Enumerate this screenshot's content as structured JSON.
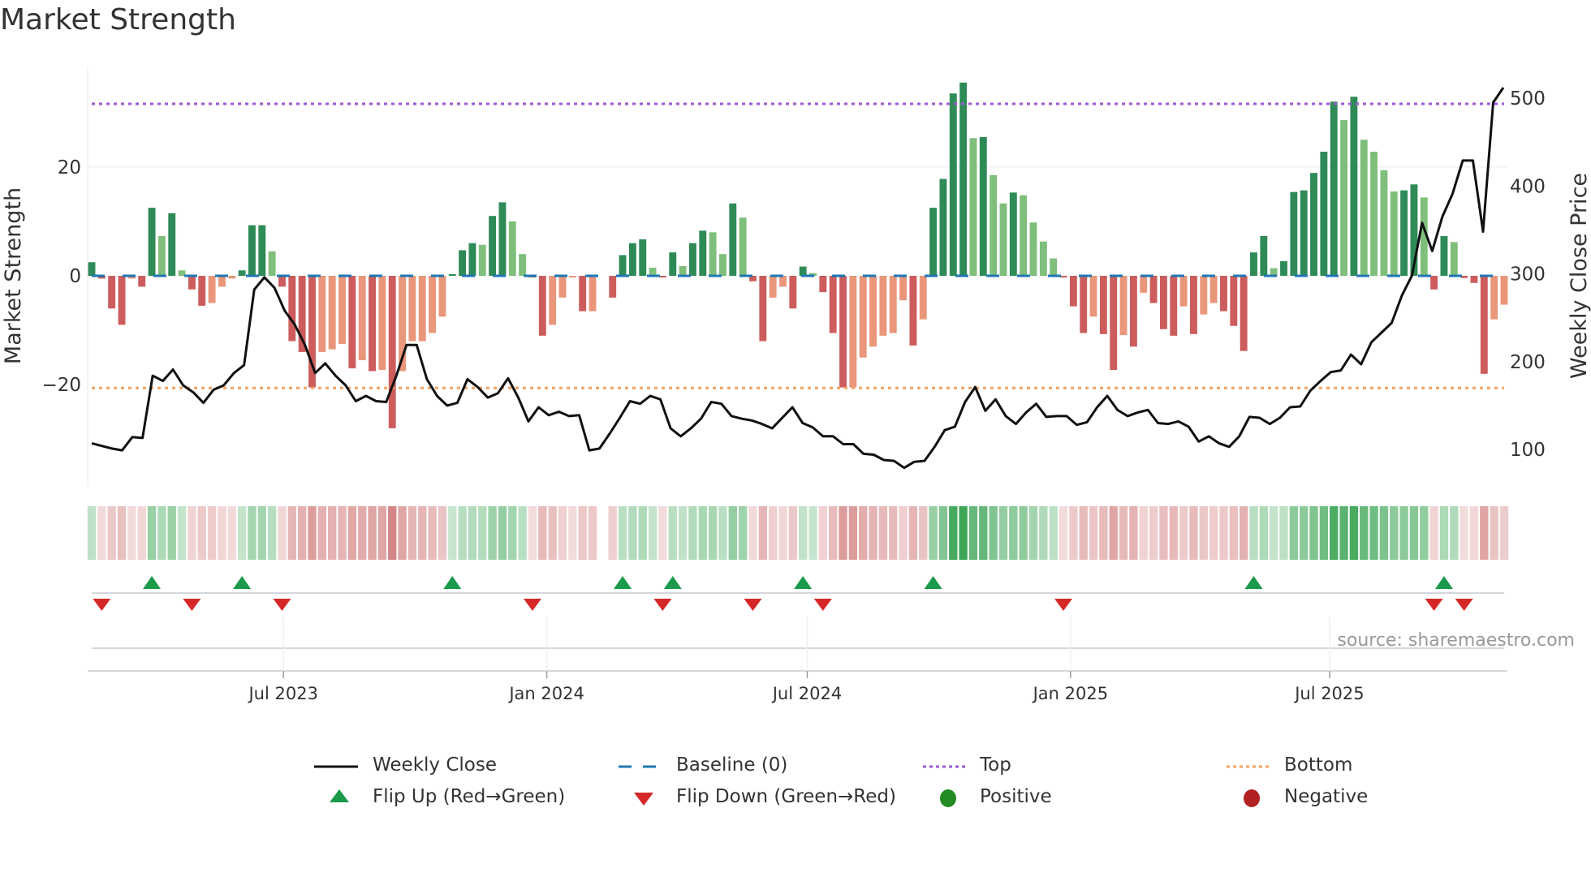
{
  "title": "Market Strength",
  "source": "source: sharemaestro.com",
  "colors": {
    "rise_pos": "#2e8b57",
    "fall_pos": "#7fbf7b",
    "fall_neg": "#cd5c5c",
    "rise_neg": "#e9967a",
    "price": "#111111",
    "baseline": "#1f77b4",
    "top": "#9b59d6",
    "bottom": "#f4a261",
    "flip_up": "#1a9a4a",
    "flip_down": "#d62728",
    "positive": "#228b22",
    "negative": "#b22222"
  },
  "chart_data": {
    "type": "bar+line",
    "title": "Market Strength",
    "ylabel": "Market Strength",
    "y2label": "Weekly Close Price",
    "ylim": [
      -37,
      39
    ],
    "y2lim": [
      35,
      545
    ],
    "yticks": [
      20,
      0,
      -20
    ],
    "ytick_labels": [
      "20",
      "0",
      "−20"
    ],
    "y2ticks": [
      500,
      400,
      300,
      200,
      100
    ],
    "y2tick_labels": [
      "500",
      "400",
      "300",
      "200",
      "100"
    ],
    "top_level": 31.6,
    "bottom_level": -20.6,
    "start_date": "2023-02-17",
    "frequency": "weekly",
    "xticks": [
      {
        "date": "2023-07-01",
        "label": "Jul 2023"
      },
      {
        "date": "2024-01-01",
        "label": "Jan 2024"
      },
      {
        "date": "2024-07-01",
        "label": "Jul 2024"
      },
      {
        "date": "2025-01-01",
        "label": "Jan 2025"
      },
      {
        "date": "2025-07-01",
        "label": "Jul 2025"
      }
    ],
    "strength": [
      2.5,
      -0.5,
      -6,
      -9,
      -0.5,
      -2,
      12.5,
      7.3,
      11.5,
      1,
      -2.5,
      -5.5,
      -5,
      -2,
      -0.5,
      1,
      9.3,
      9.3,
      4.5,
      -2,
      -12,
      -14,
      -20.5,
      -14,
      -13.5,
      -12.5,
      -17,
      -15.5,
      -17.5,
      -17.3,
      -28,
      -17.5,
      -12,
      -12,
      -10.5,
      -7.5,
      0.3,
      4.7,
      6,
      5.7,
      11,
      13.5,
      10,
      4,
      -0.3,
      -11,
      -9,
      -4,
      -0.3,
      -6.5,
      -6.5,
      0,
      -4,
      3.8,
      6,
      6.7,
      1.5,
      -0.3,
      4.3,
      1.8,
      6,
      8.3,
      8,
      4,
      13.3,
      10.7,
      -1,
      -12,
      -4,
      -2,
      -6,
      1.7,
      0.5,
      -3,
      -10.5,
      -20.5,
      -20.5,
      -15,
      -13,
      -11,
      -10.5,
      -4.5,
      -12.8,
      -8,
      12.5,
      17.8,
      33.5,
      35.5,
      25.3,
      25.5,
      18.5,
      13.3,
      15.3,
      14.8,
      9.8,
      6.3,
      3.2,
      -0.3,
      -5.6,
      -10.5,
      -7.5,
      -10.7,
      -17.3,
      -10.9,
      -13,
      -3.1,
      -5,
      -9.8,
      -11,
      -5.6,
      -10.7,
      -7.1,
      -5,
      -6.5,
      -9.2,
      -13.8,
      4.3,
      7.3,
      1.4,
      2.7,
      15.4,
      15.7,
      18.9,
      22.8,
      32,
      28.6,
      32.9,
      25,
      22.8,
      19.4,
      15.5,
      15.7,
      16.8,
      14.4,
      -2.5,
      7.3,
      6.2,
      -0.4,
      -1.3,
      -18,
      -8,
      -5.3
    ],
    "weekly_close": [
      107,
      104,
      101,
      99,
      114,
      113,
      184,
      178,
      191,
      173,
      165,
      153,
      168,
      173,
      187,
      196,
      282,
      296,
      284,
      258,
      242,
      219,
      187,
      198,
      184,
      173,
      155,
      161,
      155,
      154,
      184,
      219,
      219,
      180,
      161,
      150,
      153,
      180,
      171,
      159,
      164,
      181,
      159,
      132,
      148,
      139,
      143,
      138,
      139,
      99,
      101,
      118,
      136,
      155,
      152,
      161,
      157,
      124,
      115,
      124,
      135,
      154,
      152,
      138,
      135,
      133,
      129,
      124,
      136,
      148,
      130,
      125,
      115,
      115,
      106,
      106,
      95,
      94,
      88,
      87,
      79,
      86,
      87,
      103,
      122,
      126,
      154,
      171,
      144,
      157,
      138,
      129,
      142,
      152,
      137,
      138,
      138,
      128,
      131,
      148,
      161,
      145,
      138,
      142,
      145,
      130,
      129,
      132,
      126,
      109,
      115,
      107,
      103,
      115,
      137,
      136,
      129,
      136,
      148,
      149,
      167,
      178,
      188,
      190,
      208,
      197,
      222,
      233,
      244,
      275,
      298,
      358,
      326,
      365,
      391,
      429,
      429,
      348,
      495,
      512
    ]
  },
  "legend": [
    {
      "label": "Weekly Close",
      "symbol": "solid-line"
    },
    {
      "label": "Baseline (0)",
      "symbol": "dashed-line"
    },
    {
      "label": "Top",
      "symbol": "dotted-line"
    },
    {
      "label": "Bottom",
      "symbol": "dotted-line"
    },
    {
      "label": "Flip Up (Red→Green)",
      "symbol": "triangle-up"
    },
    {
      "label": "Flip Down (Green→Red)",
      "symbol": "triangle-down"
    },
    {
      "label": "Positive",
      "symbol": "circle"
    },
    {
      "label": "Negative",
      "symbol": "circle"
    }
  ]
}
